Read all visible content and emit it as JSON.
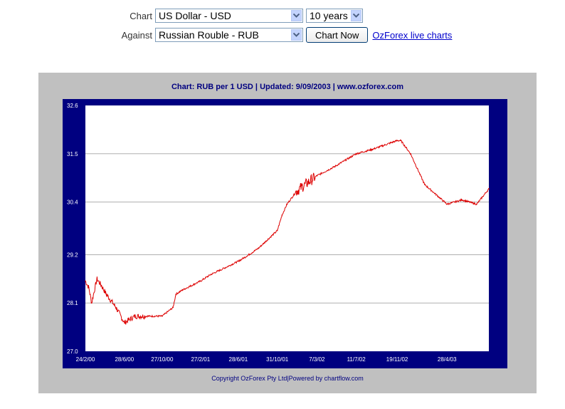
{
  "form": {
    "chart_label": "Chart",
    "chart_currency": "US Dollar - USD",
    "period": "10 years",
    "against_label": "Against",
    "against_currency": "Russian Rouble - RUB",
    "chart_now_button": "Chart Now",
    "live_charts_link": "OzForex live charts"
  },
  "chart": {
    "title": "Chart: RUB per 1 USD  |  Updated: 9/09/2003  |  www.ozforex.com",
    "footer": "Copyright OzForex Pty Ltd|Powered by chartflow.com"
  },
  "colors": {
    "frame": "#000080",
    "panel": "#c0c0c0",
    "line": "#dd0000"
  },
  "chart_data": {
    "type": "line",
    "title": "Chart: RUB per 1 USD  |  Updated: 9/09/2003  |  www.ozforex.com",
    "xlabel": "",
    "ylabel": "",
    "y_ticks": [
      27.0,
      28.1,
      29.2,
      30.4,
      31.5,
      32.6
    ],
    "ylim": [
      27.0,
      32.6
    ],
    "x_ticks": [
      "24/2/00",
      "28/6/00",
      "27/10/00",
      "27/2/01",
      "28/6/01",
      "31/10/01",
      "7/3/02",
      "11/7/02",
      "19/11/02",
      "28/4/03"
    ],
    "grid": true,
    "series": [
      {
        "values": [
          {
            "x": "24/2/00",
            "y": 28.6
          },
          {
            "x": "6/3/00",
            "y": 28.45
          },
          {
            "x": "15/3/00",
            "y": 28.1
          },
          {
            "x": "1/4/00",
            "y": 28.65
          },
          {
            "x": "15/4/00",
            "y": 28.5
          },
          {
            "x": "1/5/00",
            "y": 28.3
          },
          {
            "x": "1/6/00",
            "y": 28.0
          },
          {
            "x": "28/6/00",
            "y": 27.65
          },
          {
            "x": "1/8/00",
            "y": 27.8
          },
          {
            "x": "1/9/00",
            "y": 27.8
          },
          {
            "x": "27/10/00",
            "y": 27.8
          },
          {
            "x": "1/12/00",
            "y": 28.0
          },
          {
            "x": "10/12/00",
            "y": 28.3
          },
          {
            "x": "1/1/01",
            "y": 28.4
          },
          {
            "x": "27/2/01",
            "y": 28.6
          },
          {
            "x": "1/4/01",
            "y": 28.75
          },
          {
            "x": "1/5/01",
            "y": 28.85
          },
          {
            "x": "28/6/01",
            "y": 29.05
          },
          {
            "x": "1/8/01",
            "y": 29.2
          },
          {
            "x": "1/9/01",
            "y": 29.35
          },
          {
            "x": "1/10/01",
            "y": 29.55
          },
          {
            "x": "31/10/01",
            "y": 29.75
          },
          {
            "x": "15/11/01",
            "y": 30.1
          },
          {
            "x": "1/12/01",
            "y": 30.35
          },
          {
            "x": "1/1/02",
            "y": 30.65
          },
          {
            "x": "7/3/02",
            "y": 31.0
          },
          {
            "x": "1/5/02",
            "y": 31.2
          },
          {
            "x": "11/7/02",
            "y": 31.5
          },
          {
            "x": "1/9/02",
            "y": 31.6
          },
          {
            "x": "19/11/02",
            "y": 31.8
          },
          {
            "x": "1/12/02",
            "y": 31.8
          },
          {
            "x": "1/1/03",
            "y": 31.5
          },
          {
            "x": "15/2/03",
            "y": 30.8
          },
          {
            "x": "28/4/03",
            "y": 30.35
          },
          {
            "x": "15/6/03",
            "y": 30.45
          },
          {
            "x": "1/8/03",
            "y": 30.35
          },
          {
            "x": "9/09/2003",
            "y": 30.7
          }
        ]
      }
    ]
  }
}
